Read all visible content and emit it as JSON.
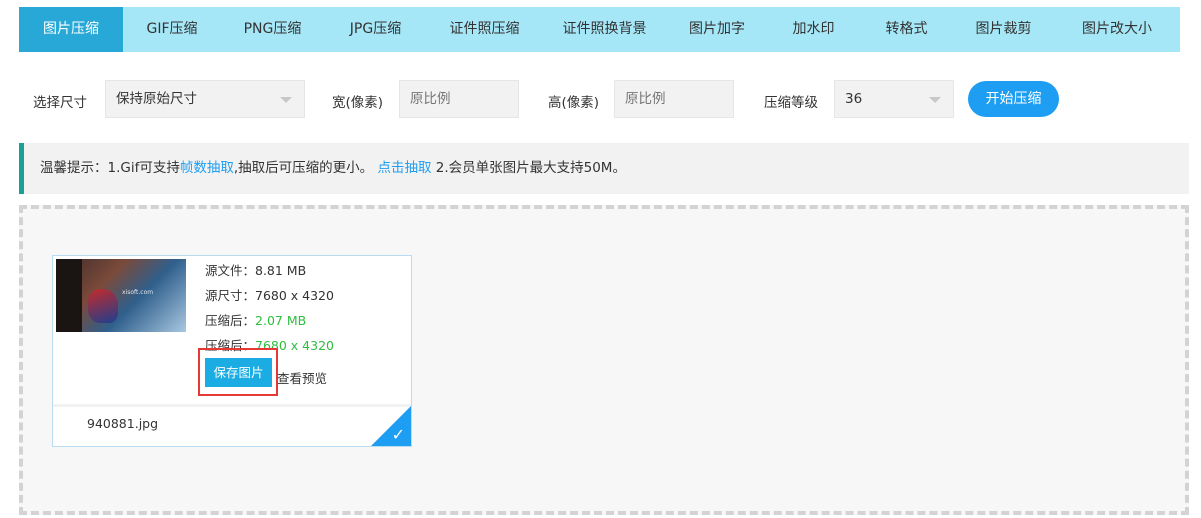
{
  "tabs": [
    {
      "label": "图片压缩",
      "active": true
    },
    {
      "label": "GIF压缩"
    },
    {
      "label": "PNG压缩"
    },
    {
      "label": "JPG压缩"
    },
    {
      "label": "证件照压缩"
    },
    {
      "label": "证件照换背景"
    },
    {
      "label": "图片加字"
    },
    {
      "label": "加水印"
    },
    {
      "label": "转格式"
    },
    {
      "label": "图片裁剪"
    },
    {
      "label": "图片改大小"
    }
  ],
  "options": {
    "size_label": "选择尺寸",
    "size_value": "保持原始尺寸",
    "width_label": "宽(像素)",
    "width_placeholder": "原比例",
    "height_label": "高(像素)",
    "height_placeholder": "原比例",
    "level_label": "压缩等级",
    "level_value": "36",
    "start_button": "开始压缩"
  },
  "tip": {
    "prefix": "温馨提示：1.Gif可支持",
    "link1": "帧数抽取",
    "middle": ",抽取后可压缩的更小。",
    "link2": "点击抽取",
    "suffix": "2.会员单张图片最大支持50M。"
  },
  "file": {
    "thumb_watermark": "xisoft.com",
    "source_size": "源文件：8.81 MB",
    "source_dims": "源尺寸：7680 x 4320",
    "compressed_label": "压缩后：",
    "compressed_size": "2.07 MB",
    "compressed_dims_label": "压缩后：",
    "compressed_dims": "7680 x 4320",
    "save_button": "保存图片",
    "preview_link": "查看预览",
    "filename": "940881.jpg",
    "check_icon": "checkmark-icon"
  },
  "colors": {
    "tab_bar": "#a6e7f7",
    "tab_active": "#27a8d6",
    "accent_blue": "#1e9ef2",
    "success_green": "#2fbd3f",
    "tip_border": "#1aa094",
    "highlight_red": "#e53935"
  }
}
